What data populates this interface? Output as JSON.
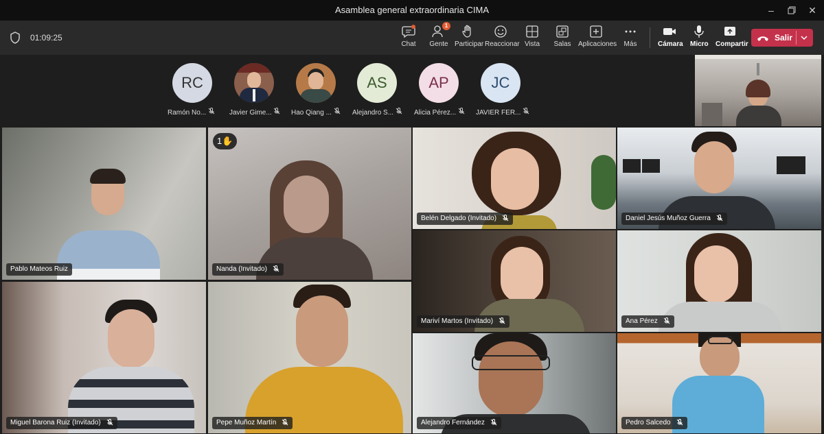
{
  "window": {
    "title": "Asamblea general extraordinaria CIMA"
  },
  "toolbar": {
    "timer": "01:09:25",
    "buttons": [
      {
        "label": "Chat",
        "icon": "chat-icon"
      },
      {
        "label": "Gente",
        "icon": "people-icon",
        "badge": "1"
      },
      {
        "label": "Participar",
        "icon": "raise-hand-icon"
      },
      {
        "label": "Reaccionar",
        "icon": "smiley-icon"
      },
      {
        "label": "Vista",
        "icon": "view-grid-icon"
      },
      {
        "label": "Salas",
        "icon": "breakout-rooms-icon"
      },
      {
        "label": "Aplicaciones",
        "icon": "apps-plus-icon"
      },
      {
        "label": "Más",
        "icon": "more-icon"
      },
      {
        "label": "Cámara",
        "icon": "camera-icon"
      },
      {
        "label": "Micro",
        "icon": "microphone-icon"
      },
      {
        "label": "Compartir",
        "icon": "share-icon"
      }
    ],
    "leave_label": "Salir"
  },
  "audience": [
    {
      "initials": "RC",
      "name": "Ramón No...",
      "color": "#d5d9e4"
    },
    {
      "initials": "",
      "name": "Javier Gime...",
      "color": "#a5684f"
    },
    {
      "initials": "",
      "name": "Hao Qiang ...",
      "color": "#b87a4a"
    },
    {
      "initials": "AS",
      "name": "Alejandro S...",
      "color": "#e3ebd7"
    },
    {
      "initials": "AP",
      "name": "Alicia Pérez...",
      "color": "#f3dde6"
    },
    {
      "initials": "JC",
      "name": "JAVIER FER...",
      "color": "#d9e5f2"
    }
  ],
  "hand_raise": {
    "count": "1",
    "emoji": "✋"
  },
  "tiles": [
    {
      "name": "Pablo Mateos Ruiz"
    },
    {
      "name": "Nanda (Invitado)"
    },
    {
      "name": "Belén Delgado (Invitado)"
    },
    {
      "name": "Daniel Jesús Muñoz Guerra"
    },
    {
      "name": "Mariví Martos (Invitado)"
    },
    {
      "name": "Ana Pérez"
    },
    {
      "name": "Miguel Barona Ruiz (Invitado)"
    },
    {
      "name": "Pepe Muñoz Martín"
    },
    {
      "name": "Alejandro Fernández"
    },
    {
      "name": "Pedro Salcedo"
    }
  ],
  "colors": {
    "leave": "#c4314b",
    "active_speaker": "#eda737",
    "badge": "#e25c33"
  }
}
